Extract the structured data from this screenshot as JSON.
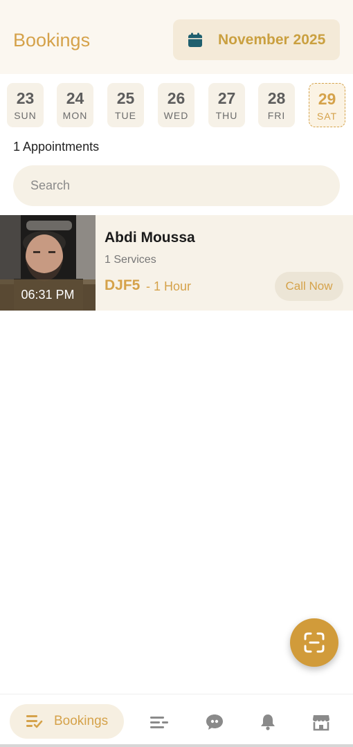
{
  "header": {
    "title": "Bookings",
    "month_label": "November 2025"
  },
  "days": [
    {
      "num": "23",
      "dow": "SUN"
    },
    {
      "num": "24",
      "dow": "MON"
    },
    {
      "num": "25",
      "dow": "TUE"
    },
    {
      "num": "26",
      "dow": "WED"
    },
    {
      "num": "27",
      "dow": "THU"
    },
    {
      "num": "28",
      "dow": "FRI"
    },
    {
      "num": "29",
      "dow": "SAT",
      "selected": true
    }
  ],
  "appointments_count": "1 Appointments",
  "search": {
    "placeholder": "Search"
  },
  "appointment": {
    "name": "Abdi Moussa",
    "services": "1 Services",
    "price": "DJF5",
    "duration": "- 1 Hour",
    "time": "06:31 PM",
    "call_label": "Call Now"
  },
  "bottom_nav": {
    "active_label": "Bookings",
    "items": [
      "bookings-icon",
      "list-icon",
      "chat-icon",
      "bell-icon",
      "store-icon"
    ]
  },
  "colors": {
    "accent": "#d5a24a",
    "calendar_icon": "#1f5f6e",
    "fab": "#d19b3a"
  }
}
